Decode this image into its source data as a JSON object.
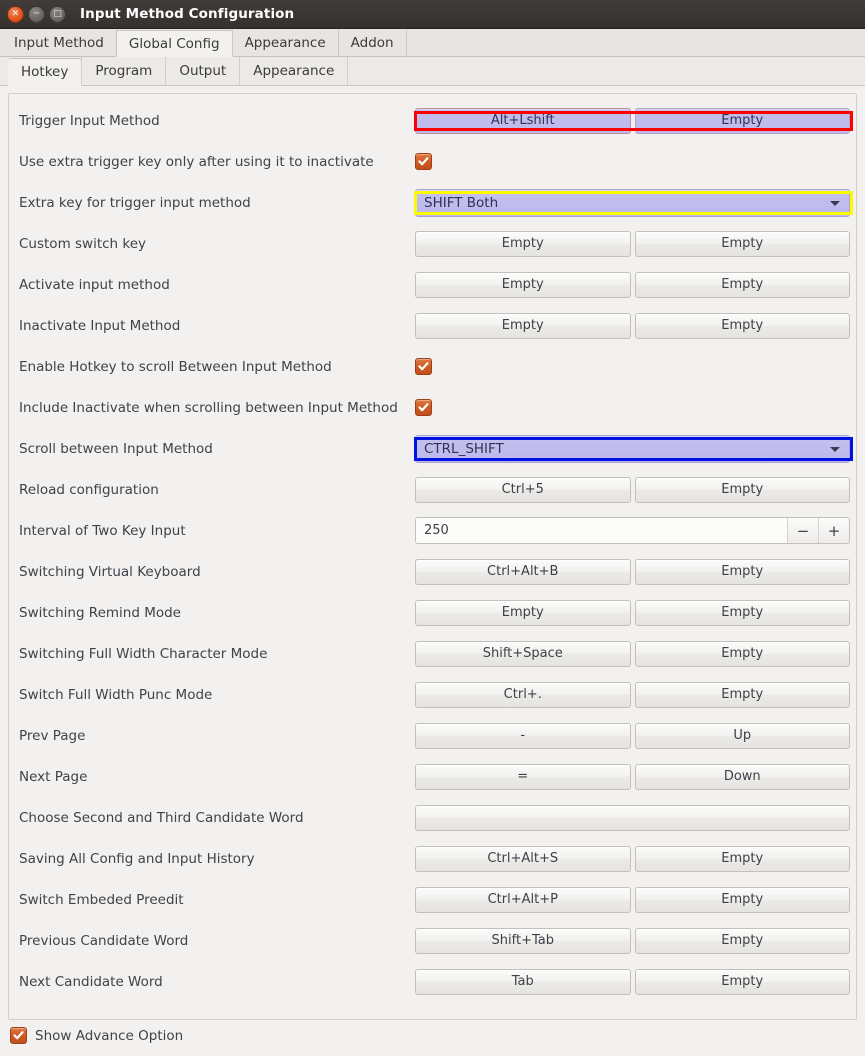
{
  "window": {
    "title": "Input Method Configuration",
    "buttons": {
      "close": "close-icon",
      "minimize": "minimize-icon",
      "maximize": "maximize-icon"
    }
  },
  "outer_tabs": [
    {
      "label": "Input Method",
      "active": false
    },
    {
      "label": "Global Config",
      "active": true
    },
    {
      "label": "Appearance",
      "active": false
    },
    {
      "label": "Addon",
      "active": false
    }
  ],
  "inner_tabs": [
    {
      "label": "Hotkey",
      "active": true
    },
    {
      "label": "Program",
      "active": false
    },
    {
      "label": "Output",
      "active": false
    },
    {
      "label": "Appearance",
      "active": false
    }
  ],
  "rows": [
    {
      "label": "Trigger Input Method",
      "type": "two-buttons",
      "left": "Alt+Lshift",
      "right": "Empty",
      "highlight": "red"
    },
    {
      "label": "Use extra trigger key only after using it to inactivate",
      "type": "checkbox",
      "checked": true
    },
    {
      "label": "Extra key for trigger input method",
      "type": "combo",
      "value": "SHIFT Both",
      "highlight": "yellow"
    },
    {
      "label": "Custom switch key",
      "type": "two-buttons",
      "left": "Empty",
      "right": "Empty"
    },
    {
      "label": "Activate input method",
      "type": "two-buttons",
      "left": "Empty",
      "right": "Empty"
    },
    {
      "label": "Inactivate Input Method",
      "type": "two-buttons",
      "left": "Empty",
      "right": "Empty"
    },
    {
      "label": "Enable Hotkey to scroll Between Input Method",
      "type": "checkbox",
      "checked": true
    },
    {
      "label": "Include Inactivate when scrolling between Input Method",
      "type": "checkbox",
      "checked": true
    },
    {
      "label": "Scroll between Input Method",
      "type": "combo",
      "value": "CTRL_SHIFT",
      "highlight": "blue"
    },
    {
      "label": "Reload configuration",
      "type": "two-buttons",
      "left": "Ctrl+5",
      "right": "Empty"
    },
    {
      "label": "Interval of Two Key Input",
      "type": "spin",
      "value": "250",
      "decrement": "−",
      "increment": "+"
    },
    {
      "label": "Switching Virtual Keyboard",
      "type": "two-buttons",
      "left": "Ctrl+Alt+B",
      "right": "Empty"
    },
    {
      "label": "Switching Remind Mode",
      "type": "two-buttons",
      "left": "Empty",
      "right": "Empty"
    },
    {
      "label": "Switching Full Width Character Mode",
      "type": "two-buttons",
      "left": "Shift+Space",
      "right": "Empty"
    },
    {
      "label": "Switch Full Width Punc Mode",
      "type": "two-buttons",
      "left": "Ctrl+.",
      "right": "Empty"
    },
    {
      "label": "Prev Page",
      "type": "two-buttons",
      "left": "-",
      "right": "Up"
    },
    {
      "label": "Next Page",
      "type": "two-buttons",
      "left": "=",
      "right": "Down"
    },
    {
      "label": "Choose Second and Third Candidate Word",
      "type": "wide-button",
      "value": ""
    },
    {
      "label": "Saving All Config and Input History",
      "type": "two-buttons",
      "left": "Ctrl+Alt+S",
      "right": "Empty"
    },
    {
      "label": "Switch Embeded Preedit",
      "type": "two-buttons",
      "left": "Ctrl+Alt+P",
      "right": "Empty"
    },
    {
      "label": "Previous Candidate Word",
      "type": "two-buttons",
      "left": "Shift+Tab",
      "right": "Empty"
    },
    {
      "label": "Next Candidate Word",
      "type": "two-buttons",
      "left": "Tab",
      "right": "Empty"
    }
  ],
  "footer": {
    "label": "Show Advance Option",
    "checked": true
  },
  "colors": {
    "titlebar": "#3b3634",
    "close_button": "#e2571f",
    "checkbox": "#cf5a23",
    "highlight_fill": "#bfbcee",
    "annotation_red": "#fe0000",
    "annotation_yellow": "#fbfa00",
    "annotation_blue": "#0013e0",
    "panel_bg": "#f2f1f0"
  }
}
